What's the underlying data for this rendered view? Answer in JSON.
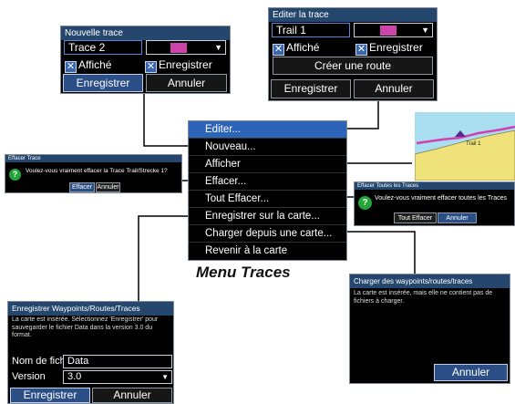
{
  "caption": "Menu Traces",
  "menu": {
    "items": [
      "Editer...",
      "Nouveau...",
      "Afficher",
      "Effacer...",
      "Tout Effacer...",
      "Enregistrer sur la carte...",
      "Charger depuis une carte...",
      "Revenir à la carte"
    ],
    "selected_index": 0
  },
  "nouvelle_trace": {
    "title": "Nouvelle trace",
    "name_value": "Trace 2",
    "color_swatch": "#cc44aa",
    "shown_label": "Affiché",
    "record_label": "Enregistrer",
    "save_button": "Enregistrer",
    "cancel_button": "Annuler"
  },
  "editer_trace": {
    "title": "Editer la trace",
    "name_value": "Trail 1",
    "color_swatch": "#cc44aa",
    "shown_label": "Affiché",
    "record_label": "Enregistrer",
    "create_route_button": "Créer une route",
    "save_button": "Enregistrer",
    "cancel_button": "Annuler"
  },
  "effacer_trace": {
    "title": "Effacer Trace",
    "question": "Voulez-vous vraiment effacer la Trace Trail/Strecke 1?",
    "erase_button": "Effacer",
    "cancel_button": "Annuler"
  },
  "effacer_toutes": {
    "title": "Effacer Toutes les Traces",
    "question": "Voulez-vous vraiment effacer toutes les Traces",
    "erase_button": "Tout Effacer",
    "cancel_button": "Annuler"
  },
  "enregistrer_dialog": {
    "title": "Enregistrer Waypoints/Routes/Traces",
    "message": "La carte est insérée. Sélectionnez 'Enregistrer' pour sauvegarder le fichier Data dans la version 3.0 du format.",
    "filename_label": "Nom de fich",
    "filename_value": "Data",
    "version_label": "Version",
    "version_value": "3.0",
    "save_button": "Enregistrer",
    "cancel_button": "Annuler"
  },
  "charger_dialog": {
    "title": "Charger des waypoints/routes/traces",
    "message": "La carte est insérée, mais elle ne contient pas de fichiers à charger.",
    "cancel_button": "Annuler"
  },
  "map_preview": {
    "track_label": "Trail 1",
    "water_color": "#a9ddf0",
    "land_color": "#efe27a",
    "track_color": "#d23fb0"
  },
  "colors": {
    "title_bar": "#25476e",
    "menu_highlight": "#2b64b8",
    "question_icon": "#22a637"
  }
}
